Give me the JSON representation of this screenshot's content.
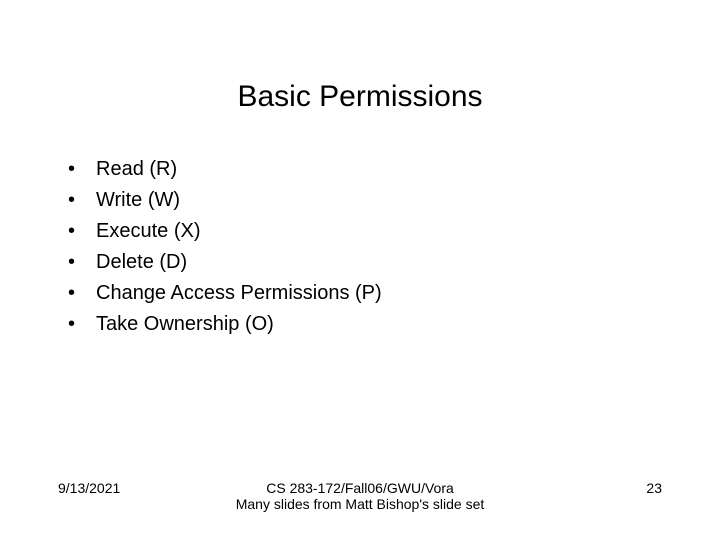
{
  "title": "Basic Permissions",
  "bullets": {
    "0": "Read (R)",
    "1": "Write (W)",
    "2": "Execute (X)",
    "3": "Delete (D)",
    "4": "Change Access Permissions (P)",
    "5": "Take Ownership (O)"
  },
  "footer": {
    "date": "9/13/2021",
    "center_line1": "CS 283-172/Fall06/GWU/Vora",
    "center_line2": "Many slides from Matt Bishop's slide set",
    "page": "23"
  }
}
